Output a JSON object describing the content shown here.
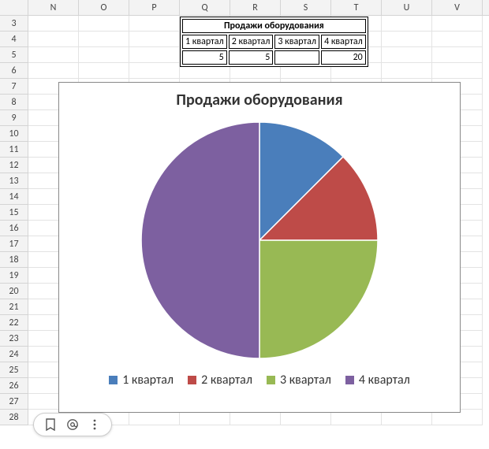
{
  "columns": [
    "N",
    "O",
    "P",
    "Q",
    "R",
    "S",
    "T",
    "U",
    "V"
  ],
  "rows": [
    "3",
    "4",
    "5",
    "6",
    "7",
    "8",
    "9",
    "10",
    "11",
    "12",
    "13",
    "14",
    "15",
    "16",
    "17",
    "18",
    "19",
    "20",
    "21",
    "22",
    "23",
    "24",
    "25",
    "26",
    "27",
    "28"
  ],
  "table": {
    "title": "Продажи оборудования",
    "headers": [
      "1 квартал",
      "2 квартал",
      "3 квартал",
      "4 квартал"
    ],
    "values": [
      "5",
      "5",
      "",
      "20"
    ]
  },
  "chart_data": {
    "type": "pie",
    "title": "Продажи оборудования",
    "categories": [
      "1 квартал",
      "2 квартал",
      "3 квартал",
      "4 квартал"
    ],
    "values": [
      5,
      5,
      10,
      20
    ],
    "colors": [
      "#4a7ebb",
      "#be4b48",
      "#98b954",
      "#7d60a0"
    ],
    "legend_position": "bottom"
  },
  "toolbar": {
    "bookmark": "bookmark",
    "mention": "mention",
    "more": "more"
  }
}
